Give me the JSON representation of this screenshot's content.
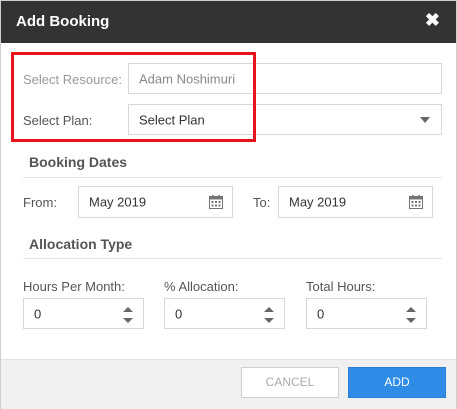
{
  "dialog": {
    "title": "Add Booking",
    "close_symbol": "✖"
  },
  "resource": {
    "label": "Select Resource:",
    "value": "Adam Noshimuri"
  },
  "plan": {
    "label": "Select Plan:",
    "value": "Select Plan"
  },
  "booking_dates": {
    "heading": "Booking Dates",
    "from_label": "From:",
    "from_value": "May 2019",
    "to_label": "To:",
    "to_value": "May 2019"
  },
  "allocation": {
    "heading": "Allocation Type",
    "hours_per_month_label": "Hours Per Month:",
    "hours_per_month_value": "0",
    "percent_label": "% Allocation:",
    "percent_value": "0",
    "total_hours_label": "Total Hours:",
    "total_hours_value": "0"
  },
  "footer": {
    "cancel_label": "CANCEL",
    "add_label": "ADD"
  },
  "colors": {
    "titlebar": "#333333",
    "highlight": "#e8141b",
    "primary": "#2e8be6"
  },
  "icons": [
    "close-icon",
    "calendar-icon",
    "chevron-down-icon",
    "spinner-icon"
  ]
}
